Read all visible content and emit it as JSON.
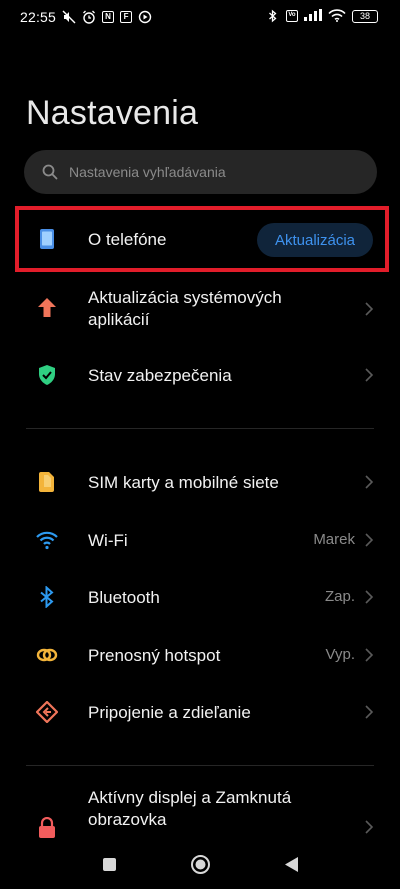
{
  "status_bar": {
    "time": "22:55",
    "battery": "38",
    "left_icons": [
      "mute-icon",
      "alarm-icon",
      "nfc-icon",
      "notification-app-icon",
      "media-icon"
    ],
    "right_icons": [
      "bluetooth-icon",
      "volte-icon",
      "signal-icon",
      "wifi-icon",
      "battery-icon"
    ]
  },
  "page": {
    "title": "Nastavenia"
  },
  "search": {
    "placeholder": "Nastavenia vyhľadávania"
  },
  "group1": [
    {
      "label": "O telefóne",
      "badge": "Aktualizácia",
      "icon": "phone-info-icon"
    },
    {
      "label": "Aktualizácia systémových aplikácií",
      "icon": "update-arrow-icon"
    },
    {
      "label": "Stav zabezpečenia",
      "icon": "shield-check-icon"
    }
  ],
  "group2": [
    {
      "label": "SIM karty a mobilné siete",
      "value": "",
      "icon": "sim-card-icon"
    },
    {
      "label": "Wi-Fi",
      "value": "Marek",
      "icon": "wifi-icon"
    },
    {
      "label": "Bluetooth",
      "value": "Zap.",
      "icon": "bluetooth-icon"
    },
    {
      "label": "Prenosný hotspot",
      "value": "Vyp.",
      "icon": "hotspot-icon"
    },
    {
      "label": "Pripojenie a zdieľanie",
      "value": "",
      "icon": "share-connection-icon"
    }
  ],
  "group3": [
    {
      "label": "Aktívny displej a Zamknutá obrazovka",
      "icon": "lock-icon"
    }
  ],
  "nav": [
    "recents-button",
    "home-button",
    "back-button"
  ],
  "colors": {
    "background": "#000000",
    "accent_blue": "#3e92ee",
    "highlight_red": "#e21d2a"
  }
}
